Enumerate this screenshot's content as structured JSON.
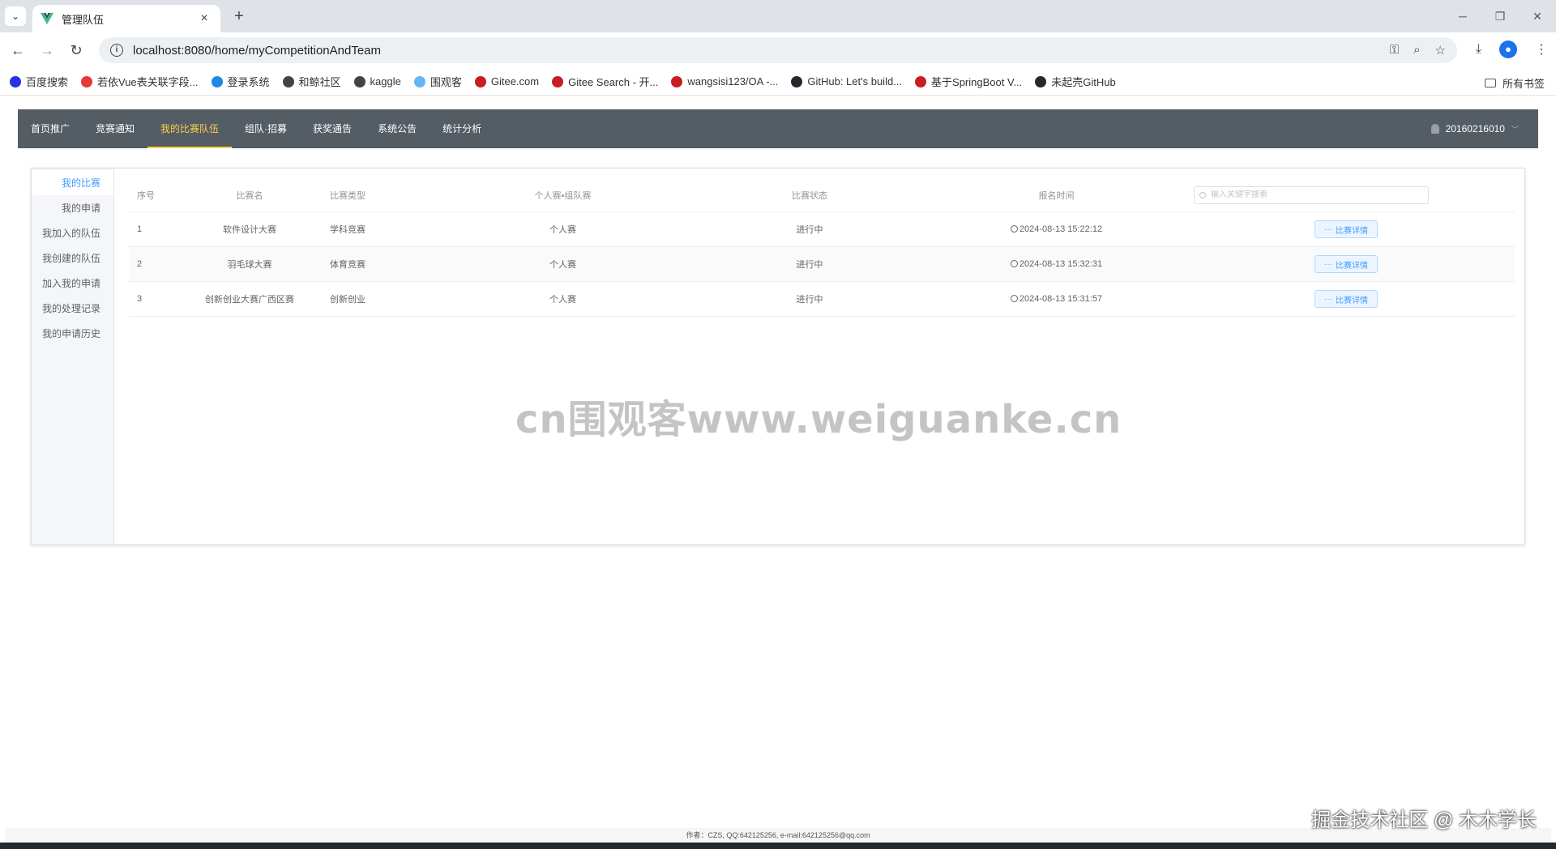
{
  "browser": {
    "tab_title": "管理队伍",
    "url": "localhost:8080/home/myCompetitionAndTeam",
    "bookmarks": [
      {
        "label": "百度搜索",
        "color": "#2932e1"
      },
      {
        "label": "若依Vue表关联字段...",
        "color": "#e53935"
      },
      {
        "label": "登录系统",
        "color": "#1e88e5"
      },
      {
        "label": "和鲸社区",
        "color": "#444444"
      },
      {
        "label": "kaggle",
        "color": "#444444"
      },
      {
        "label": "围观客",
        "color": "#64b5f6"
      },
      {
        "label": "Gitee.com",
        "color": "#c71d23"
      },
      {
        "label": "Gitee Search - 开...",
        "color": "#c71d23"
      },
      {
        "label": "wangsisi123/OA -...",
        "color": "#c71d23"
      },
      {
        "label": "GitHub: Let's build...",
        "color": "#24292f"
      },
      {
        "label": "基于SpringBoot V...",
        "color": "#c71d23"
      },
      {
        "label": "未起壳GitHub",
        "color": "#24292f"
      }
    ],
    "all_bookmarks": "所有书签"
  },
  "nav": {
    "items": [
      "首页推广",
      "竞赛通知",
      "我的比赛队伍",
      "组队·招募",
      "获奖通告",
      "系统公告",
      "统计分析"
    ],
    "active_index": 2,
    "user": "20160216010"
  },
  "side_menu": {
    "items": [
      "我的比赛",
      "我的申请",
      "我加入的队伍",
      "我创建的队伍",
      "加入我的申请",
      "我的处理记录",
      "我的申请历史"
    ],
    "active_index": 0
  },
  "table": {
    "headers": {
      "no": "序号",
      "name": "比赛名",
      "type": "比赛类型",
      "mode": "个人赛•组队赛",
      "status": "比赛状态",
      "time": "报名时间"
    },
    "search_placeholder": "输入关键字搜索",
    "detail_label": "比赛详情",
    "rows": [
      {
        "no": "1",
        "name": "软件设计大赛",
        "type": "学科竞赛",
        "mode": "个人赛",
        "status": "进行中",
        "time": "2024-08-13 15:22:12"
      },
      {
        "no": "2",
        "name": "羽毛球大赛",
        "type": "体育竞赛",
        "mode": "个人赛",
        "status": "进行中",
        "time": "2024-08-13 15:32:31"
      },
      {
        "no": "3",
        "name": "创新创业大赛广西区赛",
        "type": "创新创业",
        "mode": "个人赛",
        "status": "进行中",
        "time": "2024-08-13 15:31:57"
      }
    ]
  },
  "watermark": "cn围观客www.weiguanke.cn",
  "footer": "作者：CZS, QQ:642125256, e-mail:642125256@qq.com",
  "corner_watermark": "掘金技术社区 @ 木木学长",
  "colors": {
    "nav_bg": "#545c64",
    "nav_active": "#ffd04b",
    "link_blue": "#409eff"
  }
}
